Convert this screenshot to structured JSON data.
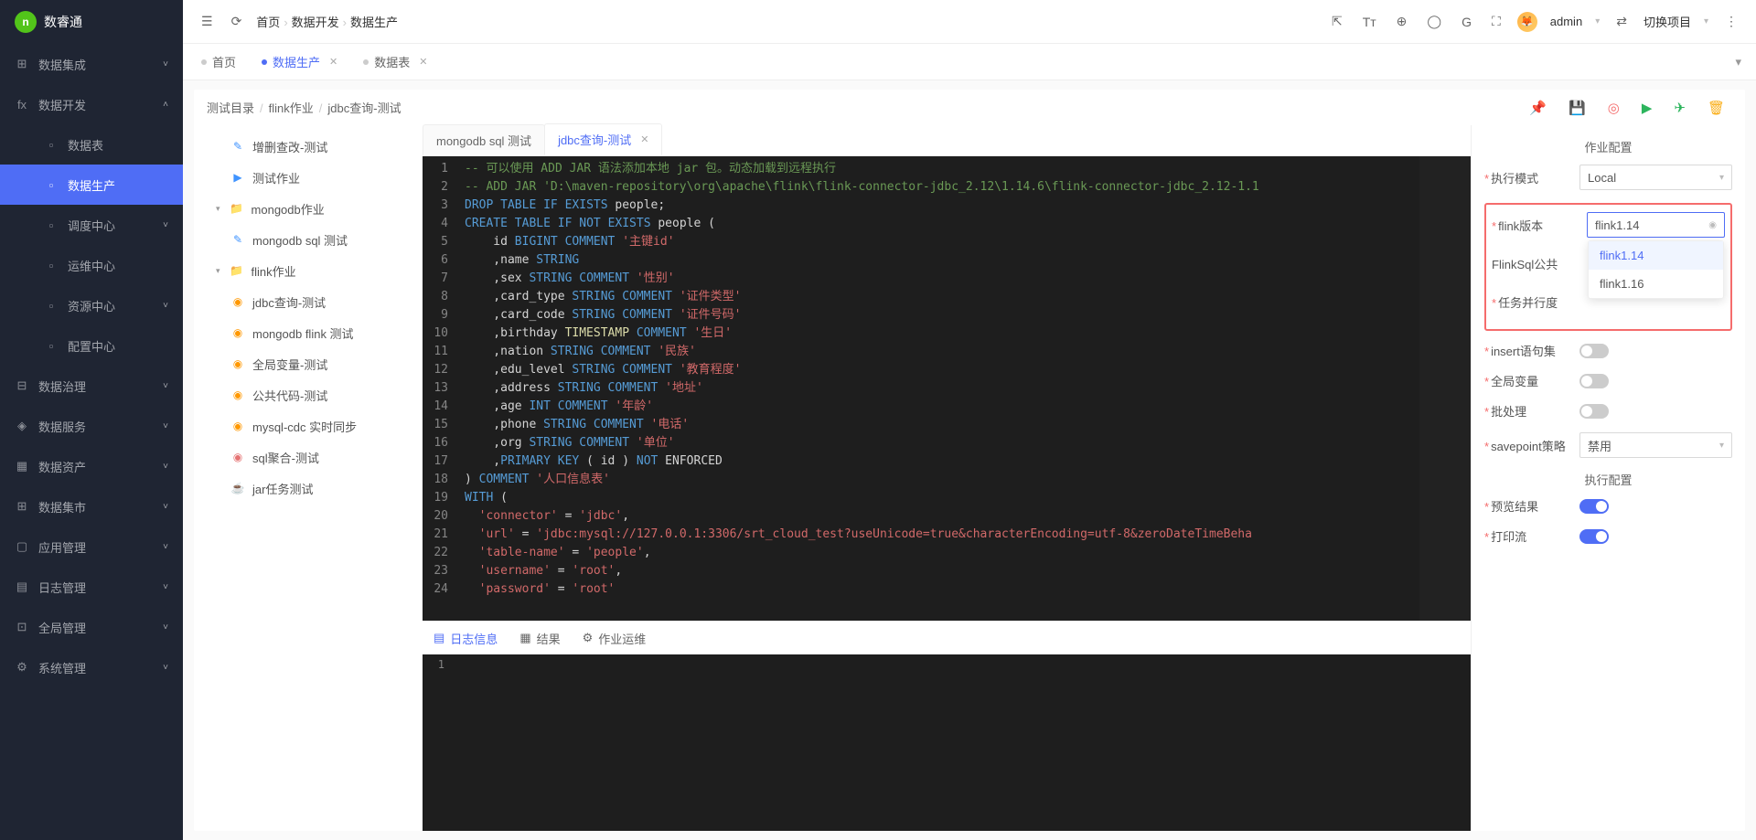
{
  "brand": "数睿通",
  "sidebar": {
    "items": [
      {
        "icon": "⊞",
        "label": "数据集成",
        "expandable": true
      },
      {
        "icon": "fx",
        "label": "数据开发",
        "expandable": true,
        "open": true,
        "children": [
          {
            "label": "数据表"
          },
          {
            "label": "数据生产",
            "active": true
          },
          {
            "label": "调度中心",
            "expandable": true
          },
          {
            "label": "运维中心"
          },
          {
            "label": "资源中心",
            "expandable": true
          },
          {
            "label": "配置中心"
          }
        ]
      },
      {
        "icon": "⊟",
        "label": "数据治理",
        "expandable": true
      },
      {
        "icon": "◈",
        "label": "数据服务",
        "expandable": true
      },
      {
        "icon": "▦",
        "label": "数据资产",
        "expandable": true
      },
      {
        "icon": "⊞",
        "label": "数据集市",
        "expandable": true
      },
      {
        "icon": "▢",
        "label": "应用管理",
        "expandable": true
      },
      {
        "icon": "▤",
        "label": "日志管理",
        "expandable": true
      },
      {
        "icon": "⊡",
        "label": "全局管理",
        "expandable": true
      },
      {
        "icon": "⚙",
        "label": "系统管理",
        "expandable": true
      }
    ]
  },
  "breadcrumb": [
    "首页",
    "数据开发",
    "数据生产"
  ],
  "top_user": "admin",
  "top_switch_project": "切换项目",
  "page_tabs": [
    {
      "label": "首页",
      "dot": "gray"
    },
    {
      "label": "数据生产",
      "dot": "blue",
      "active": true,
      "closable": true
    },
    {
      "label": "数据表",
      "dot": "gray",
      "closable": true
    }
  ],
  "inner_path": [
    "测试目录",
    "flink作业",
    "jdbc查询-测试"
  ],
  "tree": [
    {
      "label": "增删查改-测试",
      "icon": "✎",
      "cls": "ti-blue",
      "lvl": 1
    },
    {
      "label": "测试作业",
      "icon": "▶",
      "cls": "ti-blue",
      "lvl": 1
    },
    {
      "label": "mongodb作业",
      "icon": "📁",
      "cls": "ti-cyan",
      "lvl": 0,
      "caret": "▾"
    },
    {
      "label": "mongodb sql 测试",
      "icon": "✎",
      "cls": "ti-blue",
      "lvl": 1
    },
    {
      "label": "flink作业",
      "icon": "📁",
      "cls": "ti-cyan",
      "lvl": 0,
      "caret": "▾"
    },
    {
      "label": "jdbc查询-测试",
      "icon": "◉",
      "cls": "ti-orange",
      "lvl": 1
    },
    {
      "label": "mongodb flink 测试",
      "icon": "◉",
      "cls": "ti-orange",
      "lvl": 1
    },
    {
      "label": "全局变量-测试",
      "icon": "◉",
      "cls": "ti-orange",
      "lvl": 1
    },
    {
      "label": "公共代码-测试",
      "icon": "◉",
      "cls": "ti-orange",
      "lvl": 1
    },
    {
      "label": "mysql-cdc 实时同步",
      "icon": "◉",
      "cls": "ti-orange",
      "lvl": 1
    },
    {
      "label": "sql聚合-测试",
      "icon": "◉",
      "cls": "ti-red",
      "lvl": 1
    },
    {
      "label": "jar任务测试",
      "icon": "☕",
      "cls": "ti-yellow",
      "lvl": 1
    }
  ],
  "editor_tabs": [
    {
      "label": "mongodb sql 测试"
    },
    {
      "label": "jdbc查询-测试",
      "active": true,
      "closable": true
    }
  ],
  "code_lines": [
    [
      {
        "t": "-- 可以使用 ADD JAR 语法添加本地 jar 包。动态加载到远程执行",
        "c": "c-green"
      }
    ],
    [
      {
        "t": "-- ADD JAR 'D:\\maven-repository\\org\\apache\\flink\\flink-connector-jdbc_2.12\\1.14.6\\flink-connector-jdbc_2.12-1.1",
        "c": "c-green"
      }
    ],
    [
      {
        "t": "DROP",
        "c": "c-blue"
      },
      {
        "t": " "
      },
      {
        "t": "TABLE",
        "c": "c-blue"
      },
      {
        "t": " "
      },
      {
        "t": "IF",
        "c": "c-blue"
      },
      {
        "t": " "
      },
      {
        "t": "EXISTS",
        "c": "c-blue"
      },
      {
        "t": " people;"
      }
    ],
    [
      {
        "t": "CREATE",
        "c": "c-blue"
      },
      {
        "t": " "
      },
      {
        "t": "TABLE",
        "c": "c-blue"
      },
      {
        "t": " "
      },
      {
        "t": "IF",
        "c": "c-blue"
      },
      {
        "t": " "
      },
      {
        "t": "NOT",
        "c": "c-blue"
      },
      {
        "t": " "
      },
      {
        "t": "EXISTS",
        "c": "c-blue"
      },
      {
        "t": " people ("
      }
    ],
    [
      {
        "t": "    id "
      },
      {
        "t": "BIGINT",
        "c": "c-blue"
      },
      {
        "t": " "
      },
      {
        "t": "COMMENT",
        "c": "c-blue"
      },
      {
        "t": " "
      },
      {
        "t": "'主键id'",
        "c": "c-redstr"
      }
    ],
    [
      {
        "t": "    ,name "
      },
      {
        "t": "STRING",
        "c": "c-blue"
      }
    ],
    [
      {
        "t": "    ,sex "
      },
      {
        "t": "STRING",
        "c": "c-blue"
      },
      {
        "t": " "
      },
      {
        "t": "COMMENT",
        "c": "c-blue"
      },
      {
        "t": " "
      },
      {
        "t": "'性别'",
        "c": "c-redstr"
      }
    ],
    [
      {
        "t": "    ,card_type "
      },
      {
        "t": "STRING",
        "c": "c-blue"
      },
      {
        "t": " "
      },
      {
        "t": "COMMENT",
        "c": "c-blue"
      },
      {
        "t": " "
      },
      {
        "t": "'证件类型'",
        "c": "c-redstr"
      }
    ],
    [
      {
        "t": "    ,card_code "
      },
      {
        "t": "STRING",
        "c": "c-blue"
      },
      {
        "t": " "
      },
      {
        "t": "COMMENT",
        "c": "c-blue"
      },
      {
        "t": " "
      },
      {
        "t": "'证件号码'",
        "c": "c-redstr"
      }
    ],
    [
      {
        "t": "    ,birthday "
      },
      {
        "t": "TIMESTAMP",
        "c": "c-yellow"
      },
      {
        "t": " "
      },
      {
        "t": "COMMENT",
        "c": "c-blue"
      },
      {
        "t": " "
      },
      {
        "t": "'生日'",
        "c": "c-redstr"
      }
    ],
    [
      {
        "t": "    ,nation "
      },
      {
        "t": "STRING",
        "c": "c-blue"
      },
      {
        "t": " "
      },
      {
        "t": "COMMENT",
        "c": "c-blue"
      },
      {
        "t": " "
      },
      {
        "t": "'民族'",
        "c": "c-redstr"
      }
    ],
    [
      {
        "t": "    ,edu_level "
      },
      {
        "t": "STRING",
        "c": "c-blue"
      },
      {
        "t": " "
      },
      {
        "t": "COMMENT",
        "c": "c-blue"
      },
      {
        "t": " "
      },
      {
        "t": "'教育程度'",
        "c": "c-redstr"
      }
    ],
    [
      {
        "t": "    ,address "
      },
      {
        "t": "STRING",
        "c": "c-blue"
      },
      {
        "t": " "
      },
      {
        "t": "COMMENT",
        "c": "c-blue"
      },
      {
        "t": " "
      },
      {
        "t": "'地址'",
        "c": "c-redstr"
      }
    ],
    [
      {
        "t": "    ,age "
      },
      {
        "t": "INT",
        "c": "c-blue"
      },
      {
        "t": " "
      },
      {
        "t": "COMMENT",
        "c": "c-blue"
      },
      {
        "t": " "
      },
      {
        "t": "'年龄'",
        "c": "c-redstr"
      }
    ],
    [
      {
        "t": "    ,phone "
      },
      {
        "t": "STRING",
        "c": "c-blue"
      },
      {
        "t": " "
      },
      {
        "t": "COMMENT",
        "c": "c-blue"
      },
      {
        "t": " "
      },
      {
        "t": "'电话'",
        "c": "c-redstr"
      }
    ],
    [
      {
        "t": "    ,org "
      },
      {
        "t": "STRING",
        "c": "c-blue"
      },
      {
        "t": " "
      },
      {
        "t": "COMMENT",
        "c": "c-blue"
      },
      {
        "t": " "
      },
      {
        "t": "'单位'",
        "c": "c-redstr"
      }
    ],
    [
      {
        "t": "    ,"
      },
      {
        "t": "PRIMARY",
        "c": "c-blue"
      },
      {
        "t": " "
      },
      {
        "t": "KEY",
        "c": "c-blue"
      },
      {
        "t": " ( id ) "
      },
      {
        "t": "NOT",
        "c": "c-blue"
      },
      {
        "t": " ENFORCED"
      }
    ],
    [
      {
        "t": ") "
      },
      {
        "t": "COMMENT",
        "c": "c-blue"
      },
      {
        "t": " "
      },
      {
        "t": "'人口信息表'",
        "c": "c-redstr"
      }
    ],
    [
      {
        "t": "WITH",
        "c": "c-blue"
      },
      {
        "t": " ("
      }
    ],
    [
      {
        "t": "  "
      },
      {
        "t": "'connector'",
        "c": "c-redstr"
      },
      {
        "t": " = "
      },
      {
        "t": "'jdbc'",
        "c": "c-redstr"
      },
      {
        "t": ","
      }
    ],
    [
      {
        "t": "  "
      },
      {
        "t": "'url'",
        "c": "c-redstr"
      },
      {
        "t": " = "
      },
      {
        "t": "'jdbc:mysql://127.0.0.1:3306/srt_cloud_test?useUnicode=true&characterEncoding=utf-8&zeroDateTimeBeha",
        "c": "c-redstr"
      }
    ],
    [
      {
        "t": "  "
      },
      {
        "t": "'table-name'",
        "c": "c-redstr"
      },
      {
        "t": " = "
      },
      {
        "t": "'people'",
        "c": "c-redstr"
      },
      {
        "t": ","
      }
    ],
    [
      {
        "t": "  "
      },
      {
        "t": "'username'",
        "c": "c-redstr"
      },
      {
        "t": " = "
      },
      {
        "t": "'root'",
        "c": "c-redstr"
      },
      {
        "t": ","
      }
    ],
    [
      {
        "t": "  "
      },
      {
        "t": "'password'",
        "c": "c-redstr"
      },
      {
        "t": " = "
      },
      {
        "t": "'root'",
        "c": "c-redstr"
      }
    ]
  ],
  "bottom_tabs": [
    {
      "icon": "▤",
      "label": "日志信息",
      "active": true
    },
    {
      "icon": "▦",
      "label": "结果"
    },
    {
      "icon": "⚙",
      "label": "作业运维"
    }
  ],
  "config": {
    "title1": "作业配置",
    "exec_mode_label": "执行模式",
    "exec_mode_value": "Local",
    "flink_ver_label": "flink版本",
    "flink_ver_value": "flink1.14",
    "flink_ver_options": [
      "flink1.14",
      "flink1.16"
    ],
    "flinksql_common_label": "FlinkSql公共",
    "task_parallel_label": "任务并行度",
    "insert_label": "insert语句集",
    "global_var_label": "全局变量",
    "batch_label": "批处理",
    "savepoint_label": "savepoint策略",
    "savepoint_value": "禁用",
    "title2": "执行配置",
    "preview_label": "预览结果",
    "print_label": "打印流"
  }
}
